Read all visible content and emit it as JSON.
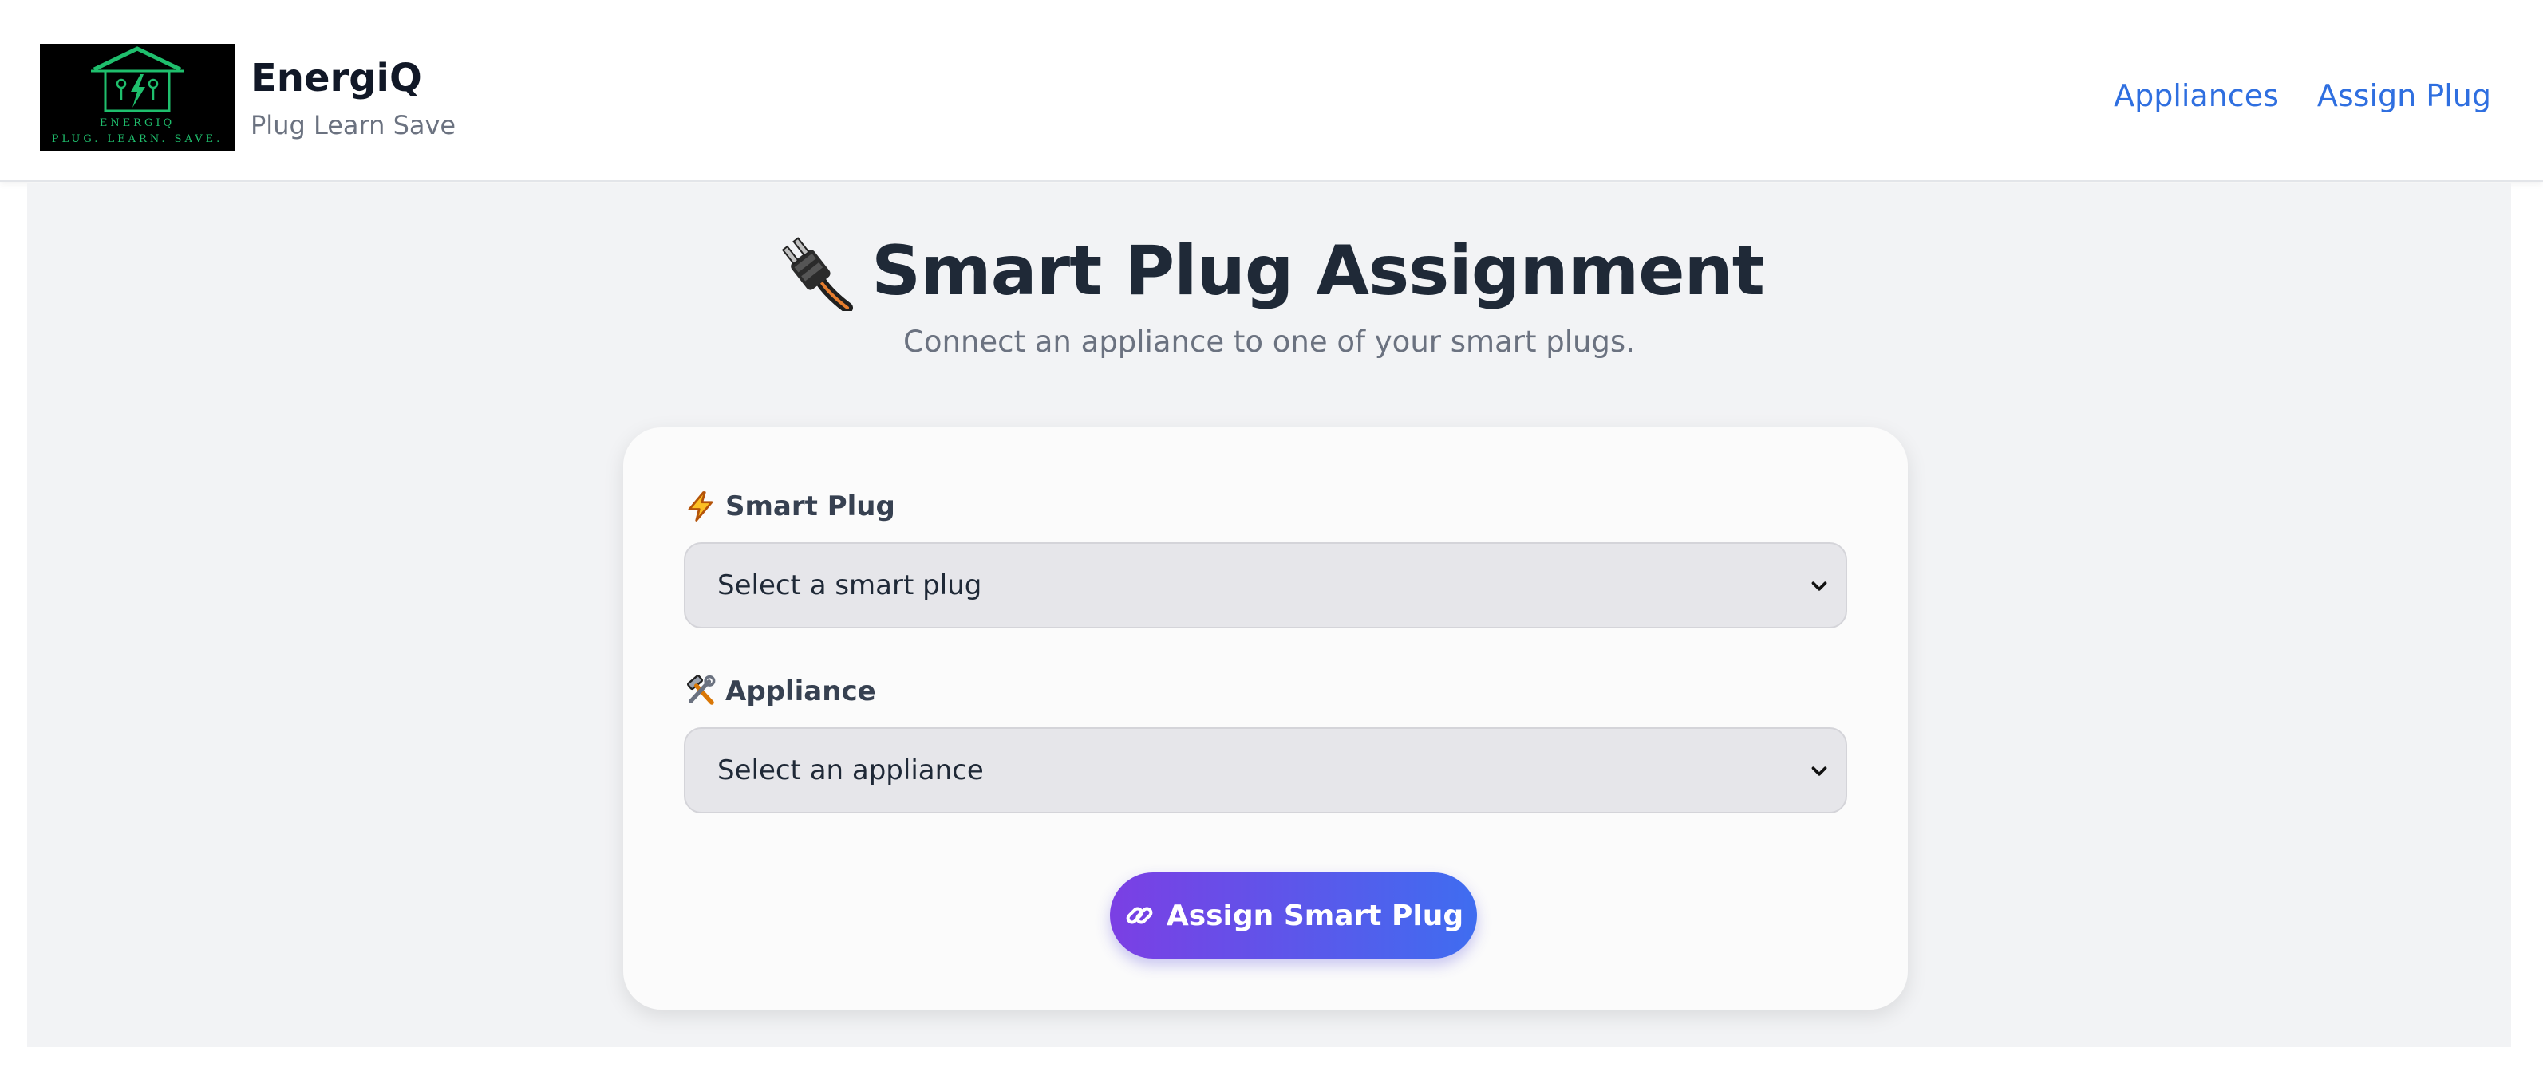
{
  "brand": {
    "logo_main": "ENERGIQ",
    "logo_tagline": "PLUG. LEARN. SAVE.",
    "name": "EnergiQ",
    "tagline": "Plug Learn Save"
  },
  "nav": {
    "items": [
      {
        "label": "Appliances",
        "icon": "none"
      },
      {
        "label": "Assign Plug",
        "icon": "none"
      }
    ]
  },
  "page": {
    "title": "Smart Plug Assignment",
    "title_icon": "plug-icon",
    "subtitle": "Connect an appliance to one of your smart plugs."
  },
  "form": {
    "smart_plug": {
      "label": "Smart Plug",
      "icon": "lightning-icon",
      "selected": "Select a smart plug"
    },
    "appliance": {
      "label": "Appliance",
      "icon": "tools-icon",
      "selected": "Select an appliance"
    },
    "submit": {
      "label": "Assign Smart Plug",
      "icon": "link-icon"
    }
  },
  "colors": {
    "accent_link": "#2f6fe0",
    "button_gradient_start": "#7b3fe4",
    "button_gradient_end": "#3f6df0",
    "logo_green": "#1fbf6d",
    "background": "#f2f3f5"
  }
}
